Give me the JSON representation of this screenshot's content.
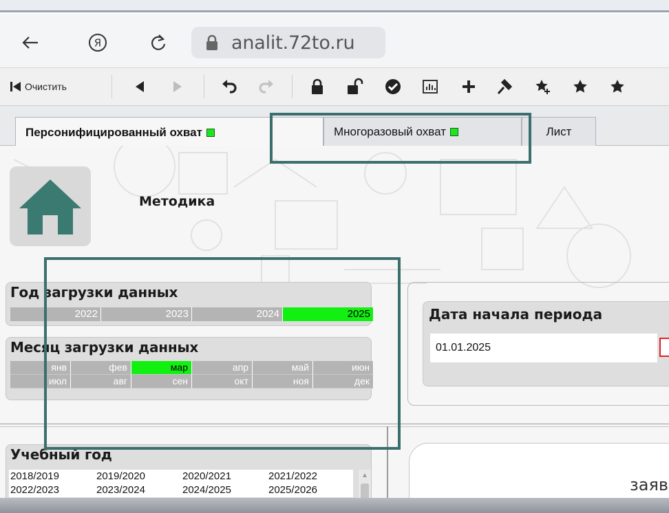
{
  "browser": {
    "back_icon": "arrow-left-icon",
    "yandex_icon": "yandex-logo-icon",
    "reload_icon": "reload-icon",
    "lock_icon": "lock-icon",
    "url": "analit.72to.ru"
  },
  "toolbar": {
    "clear_label": "Очистить",
    "icons": [
      "back-icon",
      "forward-icon",
      "undo-icon",
      "redo-icon",
      "lock-icon",
      "unlock-icon",
      "check-icon",
      "chart-icon",
      "add-icon",
      "pin-icon",
      "star-add-icon",
      "star-icon"
    ]
  },
  "tabs": [
    {
      "label": "Персонифицированный охват",
      "active": true,
      "status_color": "#1ee61e"
    },
    {
      "label": "Многоразовый охват",
      "active": false,
      "status_color": "#1ee61e"
    },
    {
      "label": "Лист",
      "active": false
    }
  ],
  "sheet": {
    "home_icon": "home-icon",
    "method_label": "Методика",
    "year_filter": {
      "title": "Год загрузки данных",
      "years": [
        "2022",
        "2023",
        "2024",
        "2025"
      ],
      "selected": "2025"
    },
    "month_filter": {
      "title": "Месяц загрузки данных",
      "months_row1": [
        "янв",
        "фев",
        "мар",
        "апр",
        "май",
        "июн"
      ],
      "months_row2": [
        "июл",
        "авг",
        "сен",
        "окт",
        "ноя",
        "дек"
      ],
      "selected": "мар"
    },
    "period_start": {
      "title": "Дата начала периода",
      "value": "01.01.2025"
    },
    "school_year": {
      "title": "Учебный год",
      "row1": [
        "2018/2019",
        "2019/2020",
        "2020/2021",
        "2021/2022"
      ],
      "row2": [
        "2022/2023",
        "2023/2024",
        "2024/2025",
        "2025/2026"
      ]
    },
    "statement_label": "заяв"
  },
  "colors": {
    "selection_green": "#12f012",
    "highlight_frame": "#3b6f6d",
    "filter_gray": "#b4b4b4"
  }
}
